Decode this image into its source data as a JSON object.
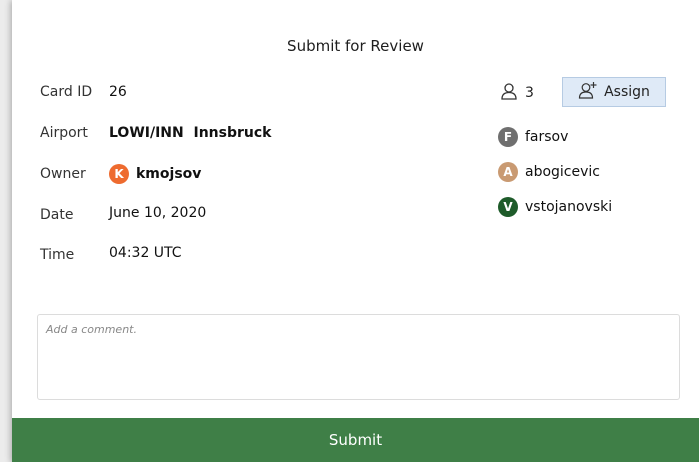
{
  "dialog": {
    "title": "Submit for Review"
  },
  "fields": {
    "card_id": {
      "label": "Card ID",
      "value": "26"
    },
    "airport": {
      "label": "Airport",
      "value": "LOWI/INN  Innsbruck"
    },
    "owner": {
      "label": "Owner",
      "value": "kmojsov",
      "initial": "K",
      "avatar_color": "#ee6b2f"
    },
    "date": {
      "label": "Date",
      "value": "June 10, 2020"
    },
    "time": {
      "label": "Time",
      "value": "04:32 UTC"
    }
  },
  "reviewers": {
    "count": "3",
    "assign_label": "Assign",
    "count_icon": "user-icon",
    "assign_icon": "add-user-icon",
    "list": [
      {
        "name": "farsov",
        "initial": "F",
        "color": "#6f6f6f"
      },
      {
        "name": "abogicevic",
        "initial": "A",
        "color": "#c99a72"
      },
      {
        "name": "vstojanovski",
        "initial": "V",
        "color": "#1e5b2a"
      }
    ]
  },
  "comment": {
    "placeholder": "Add a comment.",
    "value": ""
  },
  "submit": {
    "label": "Submit",
    "color": "#3f7f47"
  }
}
